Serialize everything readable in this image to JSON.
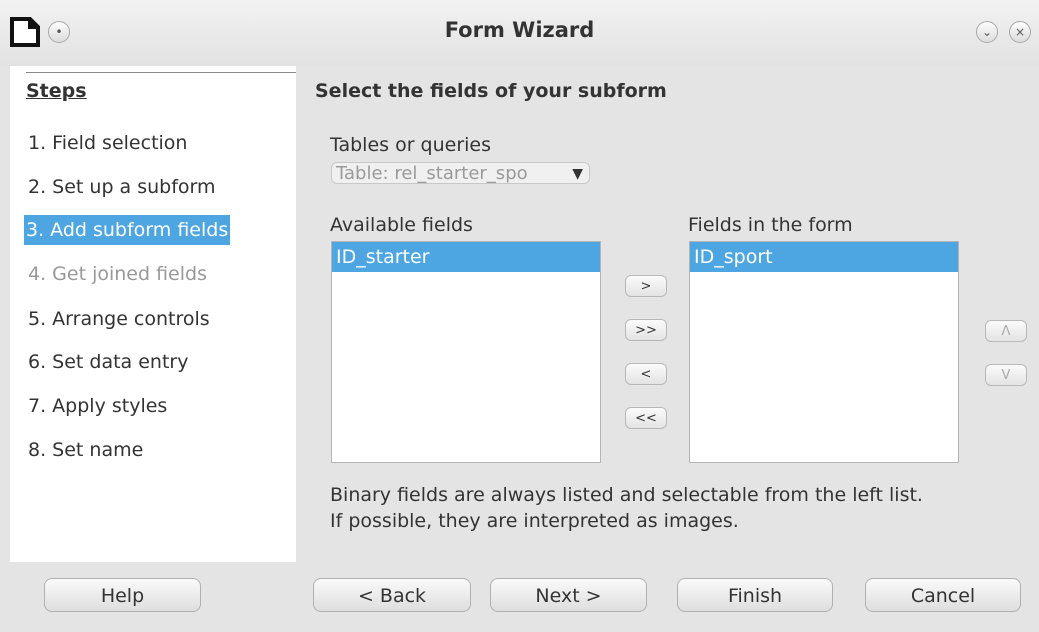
{
  "window": {
    "title": "Form Wizard"
  },
  "steps": {
    "heading": "Steps",
    "items": [
      {
        "label": "1. Field selection",
        "state": "normal"
      },
      {
        "label": "2. Set up a subform",
        "state": "normal"
      },
      {
        "label": "3. Add subform fields",
        "state": "active"
      },
      {
        "label": "4. Get joined fields",
        "state": "disabled"
      },
      {
        "label": "5. Arrange controls",
        "state": "normal"
      },
      {
        "label": "6. Set data entry",
        "state": "normal"
      },
      {
        "label": "7. Apply styles",
        "state": "normal"
      },
      {
        "label": "8. Set name",
        "state": "normal"
      }
    ]
  },
  "main": {
    "title": "Select the fields of your subform",
    "tables_label": "Tables or queries",
    "tables_value": "Table: rel_starter_spo",
    "available_label": "Available fields",
    "available_items": [
      "ID_starter"
    ],
    "form_label": "Fields in the form",
    "form_items": [
      "ID_sport"
    ],
    "move_add_one": ">",
    "move_add_all": ">>",
    "move_remove_one": "<",
    "move_remove_all": "<<",
    "order_up": "Λ",
    "order_down": "V",
    "note_line1": "Binary fields are always listed and selectable from the left list.",
    "note_line2": "If possible, they are interpreted as images."
  },
  "buttons": {
    "help": "Help",
    "back": "< Back",
    "next": "Next >",
    "finish": "Finish",
    "cancel": "Cancel"
  },
  "colors": {
    "selection": "#4da6e2",
    "disabled_text": "#999999"
  }
}
